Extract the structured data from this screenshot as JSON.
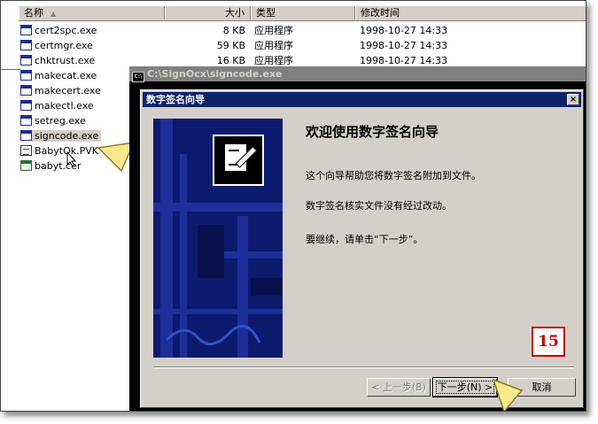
{
  "explorer": {
    "columns": {
      "name": "名称",
      "size": "大小",
      "type": "类型",
      "modified": "修改时间"
    },
    "files": [
      {
        "name": "cert2spc.exe",
        "size": "8 KB",
        "type": "应用程序",
        "modified": "1998-10-27 14:33",
        "icon": "exe-icon"
      },
      {
        "name": "certmgr.exe",
        "size": "59 KB",
        "type": "应用程序",
        "modified": "1998-10-27 14:33",
        "icon": "cert-exe-icon"
      },
      {
        "name": "chktrust.exe",
        "size": "16 KB",
        "type": "应用程序",
        "modified": "1998-10-27 14:33",
        "icon": "exe-icon"
      },
      {
        "name": "makecat.exe",
        "size": "",
        "type": "",
        "modified": "",
        "icon": "exe-icon"
      },
      {
        "name": "makecert.exe",
        "size": "",
        "type": "",
        "modified": "",
        "icon": "exe-icon"
      },
      {
        "name": "makectl.exe",
        "size": "",
        "type": "",
        "modified": "",
        "icon": "exe-icon"
      },
      {
        "name": "setreg.exe",
        "size": "",
        "type": "",
        "modified": "",
        "icon": "exe-icon"
      },
      {
        "name": "signcode.exe",
        "size": "",
        "type": "",
        "modified": "",
        "icon": "exe-icon",
        "selected": true
      },
      {
        "name": "BabytOk.PVK",
        "size": "",
        "type": "",
        "modified": "",
        "icon": "document-icon"
      },
      {
        "name": "babyt.cer",
        "size": "",
        "type": "",
        "modified": "",
        "icon": "certificate-icon"
      }
    ]
  },
  "console": {
    "title": "C:\\SignOcx\\signcode.exe",
    "icon_label": "C:\\"
  },
  "wizard": {
    "title": "数字签名向导",
    "close": "×",
    "heading": "欢迎使用数字签名向导",
    "line1": "这个向导帮助您将数字签名附加到文件。",
    "line2": "数字签名核实文件没有经过改动。",
    "line3": "要继续，请单击“下一步”。",
    "back_button": "< 上一步(B)",
    "next_button": "下一步(N) >",
    "cancel_button": "取消"
  },
  "step_badge": "15",
  "colors": {
    "titlebar": "#0a246a",
    "dialog_bg": "#d4d0c8",
    "badge": "#c00000",
    "pointer": "#f7e98c"
  }
}
